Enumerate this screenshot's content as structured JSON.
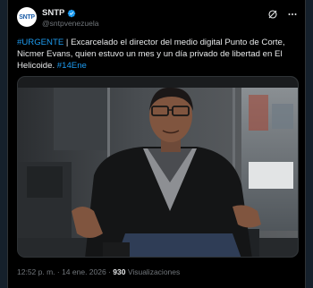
{
  "account": {
    "avatar_text": "SNTP",
    "display_name": "SNTP",
    "handle": "@sntpvenezuela",
    "verified_color": "#1d9bf0"
  },
  "tweet": {
    "hashtag_lead": "#URGENTE",
    "body": " | Excarcelado el director del medio digital Punto de Corte, Nicmer Evans, quien estuvo un mes y un día privado de libertad en El Helicoide. ",
    "hashtag_tail": "#14Ene"
  },
  "meta": {
    "timestamp": "12:52 p. m. · 14 ene. 2026 · ",
    "views_count": "930",
    "views_label": " Visualizaciones"
  },
  "icons": {
    "verified": "verified-badge-icon",
    "grok": "grok-icon",
    "more": "more-options-icon"
  },
  "colors": {
    "background": "#000000",
    "text": "#e7e9ea",
    "secondary_text": "#71767b",
    "accent": "#1d9bf0"
  }
}
